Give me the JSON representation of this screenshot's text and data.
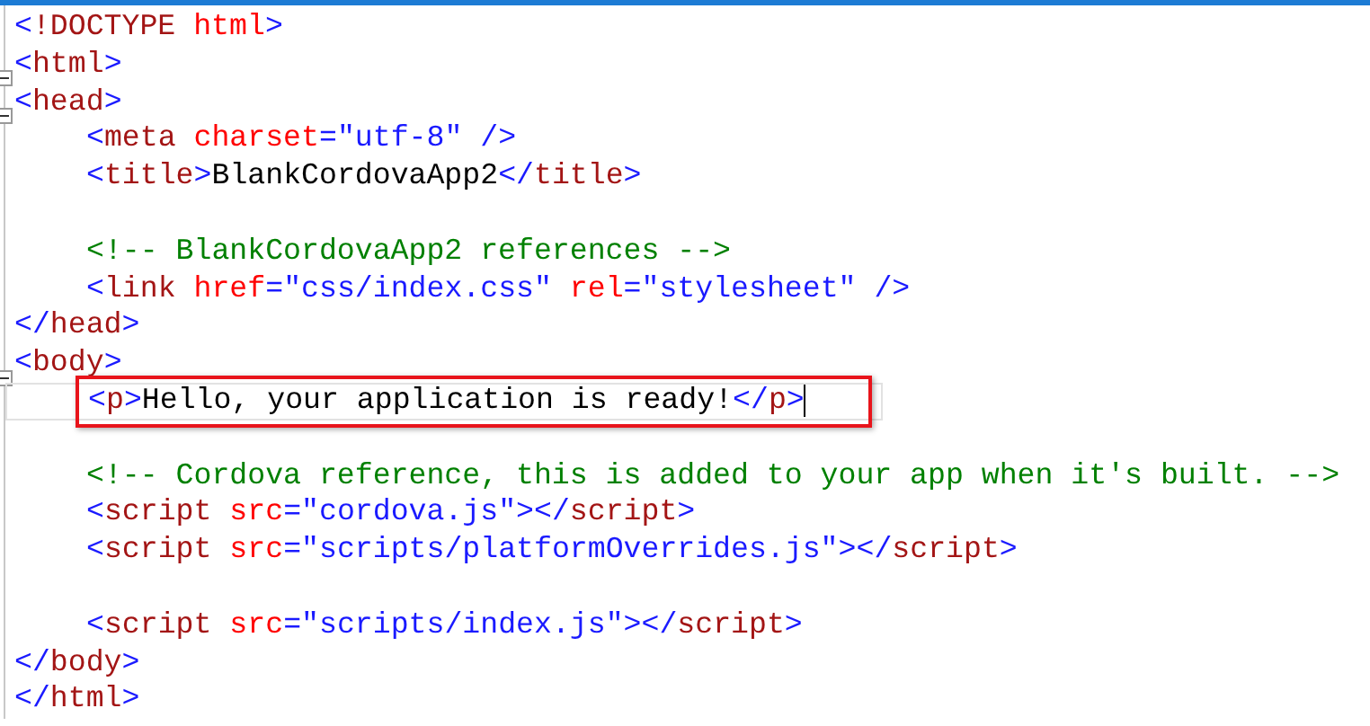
{
  "editor": {
    "lines": [
      {
        "indented": false,
        "fold": false,
        "current": false,
        "highlighted": false,
        "cursor": false,
        "tokens": [
          {
            "kind": "punct",
            "text": "<"
          },
          {
            "kind": "tag",
            "text": "!DOCTYPE"
          },
          {
            "kind": "attr",
            "text": " html"
          },
          {
            "kind": "punct",
            "text": ">"
          }
        ]
      },
      {
        "indented": false,
        "fold": true,
        "current": false,
        "highlighted": false,
        "cursor": false,
        "tokens": [
          {
            "kind": "punct",
            "text": "<"
          },
          {
            "kind": "tag",
            "text": "html"
          },
          {
            "kind": "punct",
            "text": ">"
          }
        ]
      },
      {
        "indented": false,
        "fold": true,
        "current": false,
        "highlighted": false,
        "cursor": false,
        "tokens": [
          {
            "kind": "punct",
            "text": "<"
          },
          {
            "kind": "tag",
            "text": "head"
          },
          {
            "kind": "punct",
            "text": ">"
          }
        ]
      },
      {
        "indented": true,
        "fold": false,
        "current": false,
        "highlighted": false,
        "cursor": false,
        "tokens": [
          {
            "kind": "punct",
            "text": "<"
          },
          {
            "kind": "tag",
            "text": "meta"
          },
          {
            "kind": "attr",
            "text": " charset"
          },
          {
            "kind": "punct",
            "text": "="
          },
          {
            "kind": "value",
            "text": "\"utf-8\""
          },
          {
            "kind": "punct",
            "text": " />"
          }
        ]
      },
      {
        "indented": true,
        "fold": false,
        "current": false,
        "highlighted": false,
        "cursor": false,
        "tokens": [
          {
            "kind": "punct",
            "text": "<"
          },
          {
            "kind": "tag",
            "text": "title"
          },
          {
            "kind": "punct",
            "text": ">"
          },
          {
            "kind": "text",
            "text": "BlankCordovaApp2"
          },
          {
            "kind": "punct",
            "text": "</"
          },
          {
            "kind": "tag",
            "text": "title"
          },
          {
            "kind": "punct",
            "text": ">"
          }
        ]
      },
      {
        "kind": "blank"
      },
      {
        "indented": true,
        "fold": false,
        "current": false,
        "highlighted": false,
        "cursor": false,
        "tokens": [
          {
            "kind": "comment",
            "text": "<!-- BlankCordovaApp2 references -->"
          }
        ]
      },
      {
        "indented": true,
        "fold": false,
        "current": false,
        "highlighted": false,
        "cursor": false,
        "tokens": [
          {
            "kind": "punct",
            "text": "<"
          },
          {
            "kind": "tag",
            "text": "link"
          },
          {
            "kind": "attr",
            "text": " href"
          },
          {
            "kind": "punct",
            "text": "="
          },
          {
            "kind": "value",
            "text": "\"css/index.css\""
          },
          {
            "kind": "attr",
            "text": " rel"
          },
          {
            "kind": "punct",
            "text": "="
          },
          {
            "kind": "value",
            "text": "\"stylesheet\""
          },
          {
            "kind": "punct",
            "text": " />"
          }
        ]
      },
      {
        "indented": false,
        "fold": false,
        "current": false,
        "highlighted": false,
        "cursor": false,
        "tokens": [
          {
            "kind": "punct",
            "text": "</"
          },
          {
            "kind": "tag",
            "text": "head"
          },
          {
            "kind": "punct",
            "text": ">"
          }
        ]
      },
      {
        "indented": false,
        "fold": true,
        "current": false,
        "highlighted": false,
        "cursor": false,
        "tokens": [
          {
            "kind": "punct",
            "text": "<"
          },
          {
            "kind": "tag",
            "text": "body"
          },
          {
            "kind": "punct",
            "text": ">"
          }
        ]
      },
      {
        "indented": true,
        "fold": false,
        "current": true,
        "highlighted": true,
        "cursor": true,
        "tokens": [
          {
            "kind": "punct",
            "text": "<"
          },
          {
            "kind": "tag",
            "text": "p"
          },
          {
            "kind": "punct",
            "text": ">"
          },
          {
            "kind": "text",
            "text": "Hello, your application is ready!"
          },
          {
            "kind": "punct",
            "text": "</"
          },
          {
            "kind": "tag",
            "text": "p"
          },
          {
            "kind": "punct",
            "text": ">"
          }
        ]
      },
      {
        "kind": "blank"
      },
      {
        "indented": true,
        "fold": false,
        "current": false,
        "highlighted": false,
        "cursor": false,
        "tokens": [
          {
            "kind": "comment",
            "text": "<!-- Cordova reference, this is added to your app when it's built. -->"
          }
        ]
      },
      {
        "indented": true,
        "fold": false,
        "current": false,
        "highlighted": false,
        "cursor": false,
        "tokens": [
          {
            "kind": "punct",
            "text": "<"
          },
          {
            "kind": "tag",
            "text": "script"
          },
          {
            "kind": "attr",
            "text": " src"
          },
          {
            "kind": "punct",
            "text": "="
          },
          {
            "kind": "value",
            "text": "\"cordova.js\""
          },
          {
            "kind": "punct",
            "text": "></"
          },
          {
            "kind": "tag",
            "text": "script"
          },
          {
            "kind": "punct",
            "text": ">"
          }
        ]
      },
      {
        "indented": true,
        "fold": false,
        "current": false,
        "highlighted": false,
        "cursor": false,
        "tokens": [
          {
            "kind": "punct",
            "text": "<"
          },
          {
            "kind": "tag",
            "text": "script"
          },
          {
            "kind": "attr",
            "text": " src"
          },
          {
            "kind": "punct",
            "text": "="
          },
          {
            "kind": "value",
            "text": "\"scripts/platformOverrides.js\""
          },
          {
            "kind": "punct",
            "text": "></"
          },
          {
            "kind": "tag",
            "text": "script"
          },
          {
            "kind": "punct",
            "text": ">"
          }
        ]
      },
      {
        "kind": "blank"
      },
      {
        "indented": true,
        "fold": false,
        "current": false,
        "highlighted": false,
        "cursor": false,
        "tokens": [
          {
            "kind": "punct",
            "text": "<"
          },
          {
            "kind": "tag",
            "text": "script"
          },
          {
            "kind": "attr",
            "text": " src"
          },
          {
            "kind": "punct",
            "text": "="
          },
          {
            "kind": "value",
            "text": "\"scripts/index.js\""
          },
          {
            "kind": "punct",
            "text": "></"
          },
          {
            "kind": "tag",
            "text": "script"
          },
          {
            "kind": "punct",
            "text": ">"
          }
        ]
      },
      {
        "indented": false,
        "fold": false,
        "current": false,
        "highlighted": false,
        "cursor": false,
        "tokens": [
          {
            "kind": "punct",
            "text": "</"
          },
          {
            "kind": "tag",
            "text": "body"
          },
          {
            "kind": "punct",
            "text": ">"
          }
        ]
      },
      {
        "indented": false,
        "fold": false,
        "current": false,
        "highlighted": false,
        "cursor": false,
        "tokens": [
          {
            "kind": "punct",
            "text": "</"
          },
          {
            "kind": "tag",
            "text": "html"
          },
          {
            "kind": "punct",
            "text": ">"
          }
        ]
      }
    ]
  }
}
